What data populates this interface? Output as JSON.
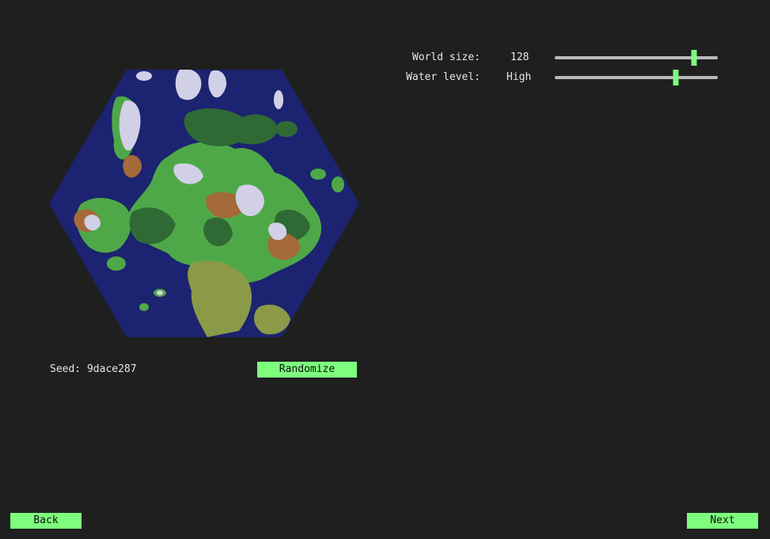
{
  "settings": {
    "world_size": {
      "label": "World size:",
      "value": "128",
      "slider_fraction": 0.855
    },
    "water_level": {
      "label": "Water level:",
      "value": "High",
      "slider_fraction": 0.745
    }
  },
  "seed": {
    "label": "Seed:",
    "value": "9dace287"
  },
  "buttons": {
    "randomize": "Randomize",
    "back": "Back",
    "next": "Next"
  },
  "colors": {
    "background": "#1f1f1f",
    "accent": "#7dfc7d",
    "ocean": "#1c2370",
    "grass": "#4fa848",
    "forest": "#2f6a34",
    "dry_grass": "#8a9a46",
    "desert": "#a46a3a",
    "snow": "#d2d0e6",
    "slider_track": "#b9b9b9"
  }
}
